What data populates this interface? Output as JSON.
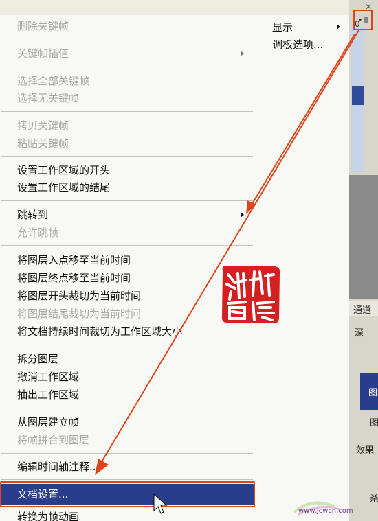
{
  "menu": {
    "items": [
      {
        "label": "删除关键帧",
        "enabled": false
      },
      {
        "label": "关键帧插值",
        "enabled": false,
        "submenu": true
      },
      {
        "label": "选择全部关键帧",
        "enabled": false
      },
      {
        "label": "选择无关键帧",
        "enabled": false
      },
      {
        "label": "拷贝关键帧",
        "enabled": false
      },
      {
        "label": "粘贴关键帧",
        "enabled": false
      },
      {
        "label": "设置工作区域的开头",
        "enabled": true
      },
      {
        "label": "设置工作区域的结尾",
        "enabled": true
      },
      {
        "label": "跳转到",
        "enabled": true,
        "submenu": true
      },
      {
        "label": "允许跳帧",
        "enabled": false
      },
      {
        "label": "将图层入点移至当前时间",
        "enabled": true
      },
      {
        "label": "将图层终点移至当前时间",
        "enabled": true
      },
      {
        "label": "将图层开头裁切为当前时间",
        "enabled": true
      },
      {
        "label": "将图层结尾裁切为当前时间",
        "enabled": false
      },
      {
        "label": "将文档持续时间裁切为工作区域大小",
        "enabled": true
      },
      {
        "label": "拆分图层",
        "enabled": true
      },
      {
        "label": "撤消工作区域",
        "enabled": true
      },
      {
        "label": "抽出工作区域",
        "enabled": true
      },
      {
        "label": "从图层建立帧",
        "enabled": true
      },
      {
        "label": "将帧拼合到图层",
        "enabled": false
      },
      {
        "label": "编辑时间轴注释...",
        "enabled": true
      },
      {
        "label": "文档设置...",
        "enabled": true,
        "highlighted": true
      },
      {
        "label": "转换为帧动画",
        "enabled": true
      }
    ]
  },
  "flyout": {
    "show_label": "显示",
    "palette_options_label": "调板选项..."
  },
  "panel": {
    "top_number": "0",
    "channels_tab": "通道",
    "deep_label": "深",
    "layer_label_1": "图",
    "layer_label_2": "图",
    "effects_label": "效果",
    "bottom_label": "杀"
  },
  "stamp": {
    "text": "冰冰儒客"
  },
  "watermark": {
    "text": "www.jcwcn.com",
    "logo_text": "中国教程网"
  },
  "colors": {
    "highlight": "#2a3c8c",
    "annotation": "#e0451a",
    "stamp": "#d42020"
  }
}
